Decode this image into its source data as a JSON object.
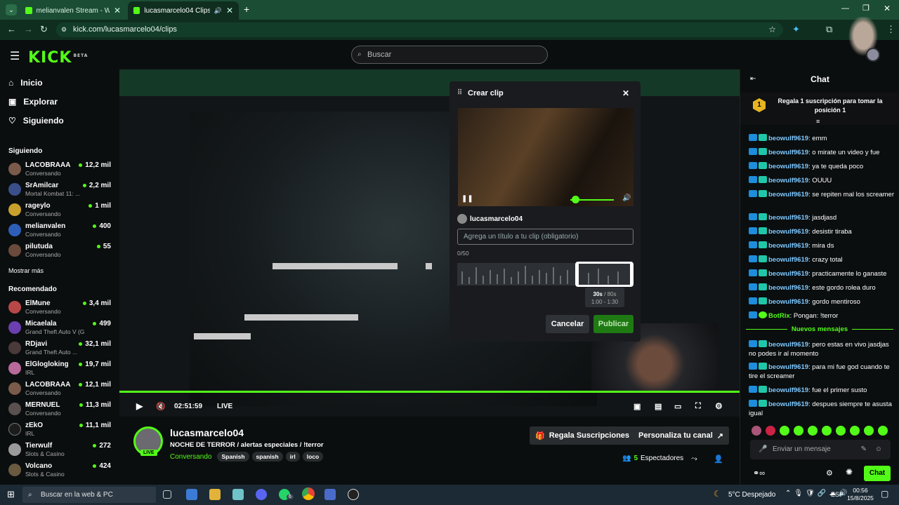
{
  "browser": {
    "tabs": [
      {
        "label": "melianvalen Stream - Watch Li..."
      },
      {
        "label": "lucasmarcelo04 Clips - Watc"
      }
    ],
    "url": "kick.com/lucasmarcelo04/clips"
  },
  "header": {
    "logo": "KICK",
    "logo_badge": "BETA",
    "search_placeholder": "Buscar"
  },
  "nav": [
    {
      "label": "Inicio",
      "icon": "home-icon"
    },
    {
      "label": "Explorar",
      "icon": "compass-icon"
    },
    {
      "label": "Siguiendo",
      "icon": "heart-icon"
    }
  ],
  "following": {
    "title": "Siguiendo",
    "show_more": "Mostrar más",
    "channels": [
      {
        "name": "LACOBRAAA",
        "category": "Conversando",
        "viewers": "12,2 mil"
      },
      {
        "name": "SrAmilcar",
        "category": "Mortal Kombat 11: ...",
        "viewers": "2,2 mil"
      },
      {
        "name": "rageylo",
        "category": "Conversando",
        "viewers": "1 mil"
      },
      {
        "name": "melianvalen",
        "category": "Conversando",
        "viewers": "400"
      },
      {
        "name": "pilutuda",
        "category": "Conversando",
        "viewers": "55"
      }
    ]
  },
  "recommended": {
    "title": "Recomendado",
    "channels": [
      {
        "name": "ElMune",
        "category": "Conversando",
        "viewers": "3,4 mil"
      },
      {
        "name": "Micaelala",
        "category": "Grand Theft Auto V (G...",
        "viewers": "499"
      },
      {
        "name": "RDjavi",
        "category": "Grand Theft Auto ...",
        "viewers": "32,1 mil"
      },
      {
        "name": "ElGlogloking",
        "category": "IRL",
        "viewers": "19,7 mil"
      },
      {
        "name": "LACOBRAAA",
        "category": "Conversando",
        "viewers": "12,1 mil"
      },
      {
        "name": "MERNUEL",
        "category": "Conversando",
        "viewers": "11,3 mil"
      },
      {
        "name": "zEkO",
        "category": "IRL",
        "viewers": "11,1 mil"
      },
      {
        "name": "Tierwulf",
        "category": "Slots & Casino",
        "viewers": "272"
      },
      {
        "name": "Volcano",
        "category": "Slots & Casino",
        "viewers": "424"
      }
    ]
  },
  "player": {
    "time": "02:51:59",
    "live": "LIVE"
  },
  "clip": {
    "title": "Crear clip",
    "channel": "lucasmarcelo04",
    "title_placeholder": "Agrega un título a tu clip (obligatorio)",
    "char_count": "0/50",
    "duration": "30s",
    "duration_max": "/ 80s",
    "range": "1:00 - 1:30",
    "cancel": "Cancelar",
    "publish": "Publicar"
  },
  "stream": {
    "channel": "lucasmarcelo04",
    "title": "NOCHE DE TERROR / alertas especiales / !terror",
    "category": "Conversando",
    "tags": [
      "Spanish",
      "spanish",
      "irl",
      "loco"
    ],
    "live_badge": "LIVE",
    "subs_btn": "Regala Suscripciones",
    "customize_btn": "Personaliza tu canal",
    "viewers": "5",
    "viewers_label": "Espectadores"
  },
  "chat": {
    "title": "Chat",
    "promo": "Regala 1 suscripción para tomar la posición 1",
    "promo_rank": "1",
    "new_messages": "Nuevos mensajes",
    "input_placeholder": "Enviar un mensaje",
    "send": "Chat",
    "messages": [
      {
        "user": "beowulf9619",
        "text": ": emm"
      },
      {
        "user": "beowulf9619",
        "text": ": o mirate un video y fue"
      },
      {
        "user": "beowulf9619",
        "text": ": ya te queda poco"
      },
      {
        "user": "beowulf9619",
        "text": ": OUUU"
      },
      {
        "user": "beowulf9619",
        "text": ": se repiten mal los screamer"
      },
      {
        "user": "beowulf9619",
        "text": ": jasdjasd"
      },
      {
        "user": "beowulf9619",
        "text": ": desistir tiraba"
      },
      {
        "user": "beowulf9619",
        "text": ": mira ds"
      },
      {
        "user": "beowulf9619",
        "text": ": crazy total"
      },
      {
        "user": "beowulf9619",
        "text": ": practicamente lo ganaste"
      },
      {
        "user": "beowulf9619",
        "text": ": este gordo rolea duro"
      },
      {
        "user": "beowulf9619",
        "text": ": gordo mentiroso"
      },
      {
        "user": "BotRix",
        "text": ": Pongan: !terror"
      },
      {
        "user": "beowulf9619",
        "text": ": pero estas en vivo jasdjas no podes ir al momento"
      },
      {
        "user": "beowulf9619",
        "text": ": para mi fue god cuando te tire el screamer"
      },
      {
        "user": "beowulf9619",
        "text": ": fue el primer susto"
      },
      {
        "user": "beowulf9619",
        "text": ": despues siempre te asusta igual"
      }
    ]
  },
  "taskbar": {
    "search": "Buscar en la web & PC",
    "weather": "5°C Despejado",
    "lang": "ESP",
    "time": "00:56",
    "date": "15/8/2025",
    "badge": "6"
  },
  "colors": {
    "brand": "#53fc18",
    "username": "#7cc8ff"
  }
}
